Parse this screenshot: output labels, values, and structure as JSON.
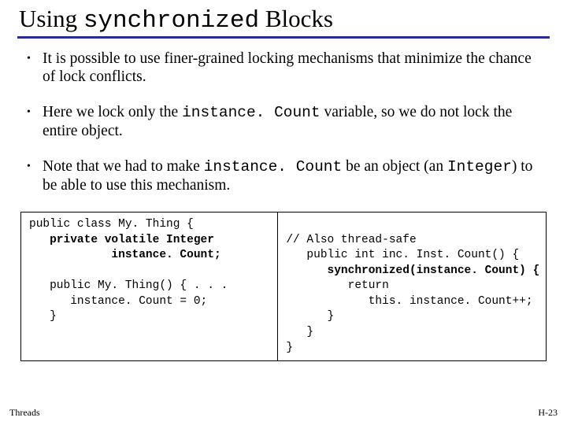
{
  "title": {
    "pre": "Using ",
    "mono": "synchronized",
    "post": " Blocks"
  },
  "bullets": [
    {
      "parts": [
        {
          "t": "It is possible to use finer-grained locking mechanisms that minimize the chance of lock conflicts."
        }
      ]
    },
    {
      "parts": [
        {
          "t": "Here we lock only the "
        },
        {
          "t": "instance. Count",
          "mono": true
        },
        {
          "t": " variable, so we do not lock the entire object."
        }
      ]
    },
    {
      "parts": [
        {
          "t": "Note that we had to make "
        },
        {
          "t": "instance. Count",
          "mono": true
        },
        {
          "t": " be an object (an "
        },
        {
          "t": "Integer",
          "mono": true
        },
        {
          "t": ") to be able to use this mechanism."
        }
      ]
    }
  ],
  "code_left": [
    {
      "t": "public class My. Thing {"
    },
    {
      "t": "   private volatile Integer",
      "b": true
    },
    {
      "t": "            instance. Count;",
      "b": true
    },
    {
      "t": ""
    },
    {
      "t": "   public My. Thing() { . . ."
    },
    {
      "t": "      instance. Count = 0;"
    },
    {
      "t": "   }"
    }
  ],
  "code_right": [
    {
      "t": ""
    },
    {
      "t": "// Also thread-safe"
    },
    {
      "t": "   public int inc. Inst. Count() {"
    },
    {
      "t": "      synchronized(instance. Count) {",
      "b": true
    },
    {
      "t": "         return"
    },
    {
      "t": "            this. instance. Count++;"
    },
    {
      "t": "      }"
    },
    {
      "t": "   }"
    },
    {
      "t": "}"
    }
  ],
  "footer": {
    "left": "Threads",
    "right": "H-23"
  }
}
